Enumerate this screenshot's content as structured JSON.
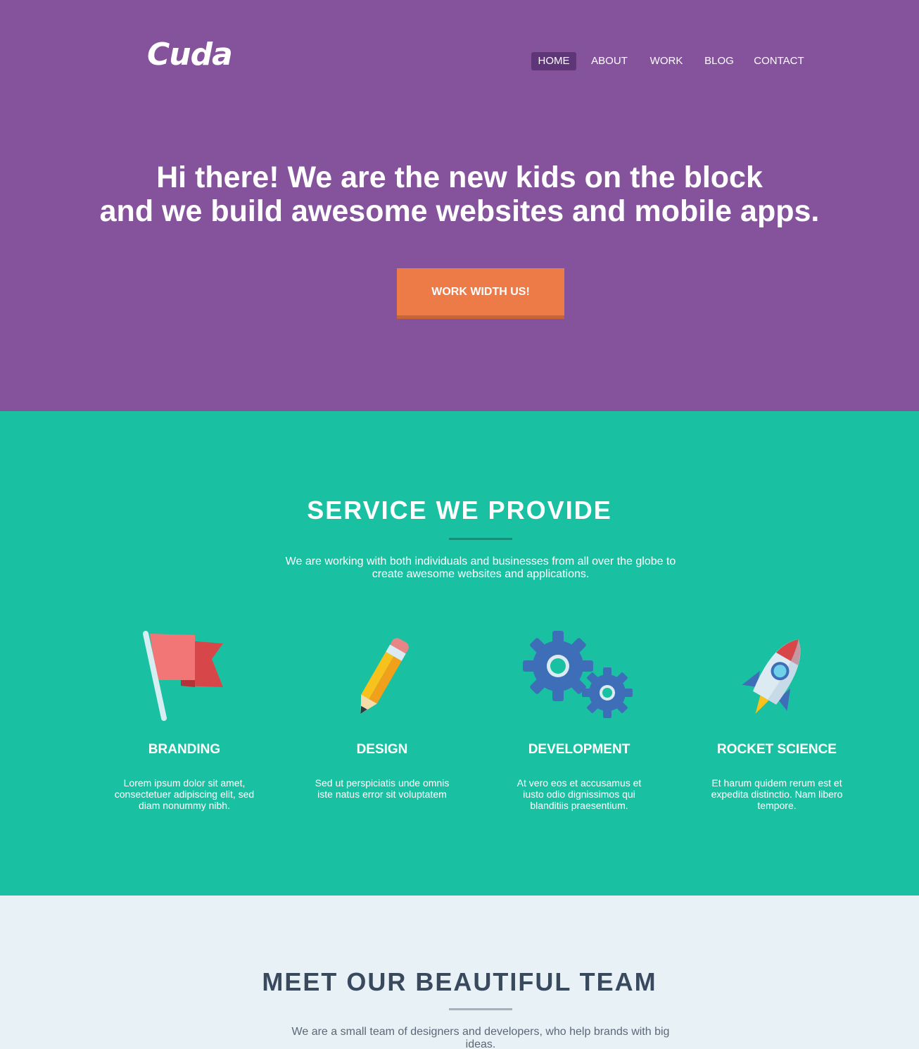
{
  "brand": {
    "logo": "Cuda"
  },
  "nav": {
    "items": [
      {
        "label": "HOME",
        "active": true
      },
      {
        "label": "ABOUT",
        "active": false
      },
      {
        "label": "WORK",
        "active": false
      },
      {
        "label": "BLOG",
        "active": false
      },
      {
        "label": "CONTACT",
        "active": false
      }
    ]
  },
  "hero": {
    "line1": "Hi there! We are the new kids on the block",
    "line2": "and we build awesome websites and mobile apps.",
    "cta": "WORK WIDTH US!"
  },
  "services": {
    "title": "SERVICE WE PROVIDE",
    "text": "We are working with both individuals and businesses from all over the globe to create awesome websites and applications.",
    "items": [
      {
        "icon": "flag-icon",
        "title": "BRANDING",
        "text": "Lorem ipsum dolor sit amet, consectetuer adipiscing elit, sed diam nonummy nibh."
      },
      {
        "icon": "pencil-icon",
        "title": "DESIGN",
        "text": "Sed ut perspiciatis unde omnis iste natus error sit voluptatem"
      },
      {
        "icon": "gears-icon",
        "title": "DEVELOPMENT",
        "text": "At vero eos et accusamus et iusto odio dignissimos qui blanditiis praesentium."
      },
      {
        "icon": "rocket-icon",
        "title": "ROCKET SCIENCE",
        "text": "Et harum quidem rerum est et expedita distinctio. Nam libero tempore."
      }
    ]
  },
  "team": {
    "title": "MEET OUR BEAUTIFUL TEAM",
    "text": "We are a small team of designers and developers, who help brands with big ideas."
  },
  "colors": {
    "hero_bg": "#85539c",
    "nav_active": "#5e3678",
    "cta": "#ec7b48",
    "services_bg": "#19c1a2",
    "team_bg": "#e8f1f5",
    "dark_text": "#3a4a5e"
  }
}
